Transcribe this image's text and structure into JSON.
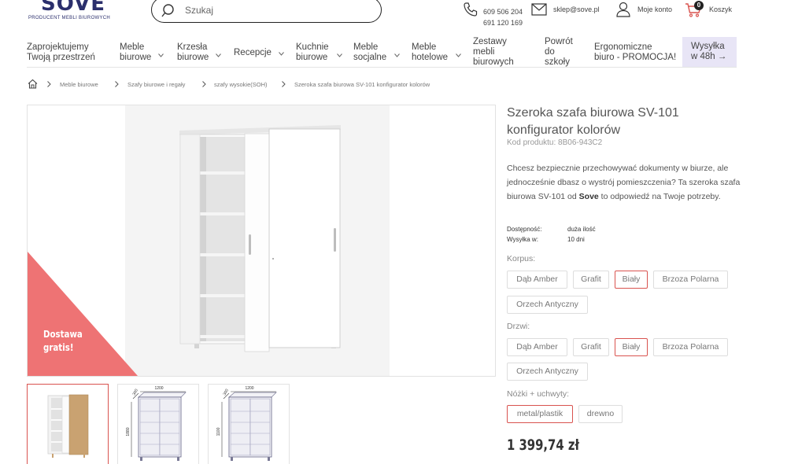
{
  "header": {
    "logo_word": "SOVE",
    "logo_tagline": "PRODUCENT MEBLI BIUROWYCH",
    "search_placeholder": "Szukaj",
    "phones": [
      "609 506 204",
      "691 120 169"
    ],
    "email": "sklep@sove.pl",
    "account_label": "Moje konto",
    "cart_label": "Koszyk",
    "cart_count": "0"
  },
  "nav": {
    "items": [
      {
        "line1": "Zaprojektujemy",
        "line2": "Twoją przestrzeń",
        "line3": ""
      },
      {
        "line1": "Meble",
        "line2": "biurowe",
        "line3": ""
      },
      {
        "line1": "Krzesła",
        "line2": "biurowe",
        "line3": ""
      },
      {
        "line1": "Recepcje",
        "line2": "",
        "line3": ""
      },
      {
        "line1": "Kuchnie",
        "line2": "biurowe",
        "line3": ""
      },
      {
        "line1": "Meble",
        "line2": "socjalne",
        "line3": ""
      },
      {
        "line1": "Meble",
        "line2": "hotelowe",
        "line3": ""
      },
      {
        "line1": "Zestawy",
        "line2": "mebli",
        "line3": "biurowych"
      },
      {
        "line1": "Powrót",
        "line2": "do",
        "line3": "szkoły"
      },
      {
        "line1": "Ergonomiczne",
        "line2": "biuro - PROMOCJA!",
        "line3": ""
      },
      {
        "line1": "Wysyłka",
        "line2": "w 48h →",
        "line3": ""
      }
    ]
  },
  "breadcrumb": [
    "Meble biurowe",
    "Szafy biurowe i regały",
    "szafy wysokie(SOH)",
    "Szeroka szafa biurowa SV-101 konfigurator kolorów"
  ],
  "gallery": {
    "promo_line1": "Dostawa",
    "promo_line2": "gratis!",
    "thumbs": [
      {
        "width_label": "",
        "depth_label": "",
        "height_label": ""
      },
      {
        "width_label": "1200",
        "depth_label": "300",
        "height_label": "1880"
      },
      {
        "width_label": "1200",
        "depth_label": "300",
        "height_label": "1100"
      }
    ]
  },
  "product": {
    "title": "Szeroka szafa biurowa SV-101 konfigurator kolorów",
    "code": "Kod produktu: 8B06-943C2",
    "desc_part1": "Chcesz bezpiecznie przechowywać dokumenty w biurze, ale jednocześnie dbasz o wystrój pomieszczenia? Ta szeroka szafa biurowa SV-101 od ",
    "desc_brand": "Sove",
    "desc_part2": " to odpowiedź na Twoje potrzeby.",
    "availability_label": "Dostępność:",
    "availability_value": "duża ilość",
    "shipping_label": "Wysyłka w:",
    "shipping_value": "10 dni",
    "korpus_label": "Korpus:",
    "korpus_options": [
      {
        "label": "Dąb Amber",
        "selected": false
      },
      {
        "label": "Grafit",
        "selected": false
      },
      {
        "label": "Biały",
        "selected": true
      },
      {
        "label": "Brzoza Polarna",
        "selected": false
      },
      {
        "label": "Orzech Antyczny",
        "selected": false
      }
    ],
    "drzwi_label": "Drzwi:",
    "drzwi_options": [
      {
        "label": "Dąb Amber",
        "selected": false
      },
      {
        "label": "Grafit",
        "selected": false
      },
      {
        "label": "Biały",
        "selected": true
      },
      {
        "label": "Brzoza Polarna",
        "selected": false
      },
      {
        "label": "Orzech Antyczny",
        "selected": false
      }
    ],
    "legs_label": "Nóżki + uchwyty:",
    "legs_options": [
      {
        "label": "metal/plastik",
        "selected": true
      },
      {
        "label": "drewno",
        "selected": false
      }
    ],
    "price": "1 399,74 zł"
  },
  "colors": {
    "accent": "#d9534f",
    "promo": "#ee7374",
    "brand": "#2b2f6c",
    "promo_nav_bg": "#e8e5f6"
  }
}
